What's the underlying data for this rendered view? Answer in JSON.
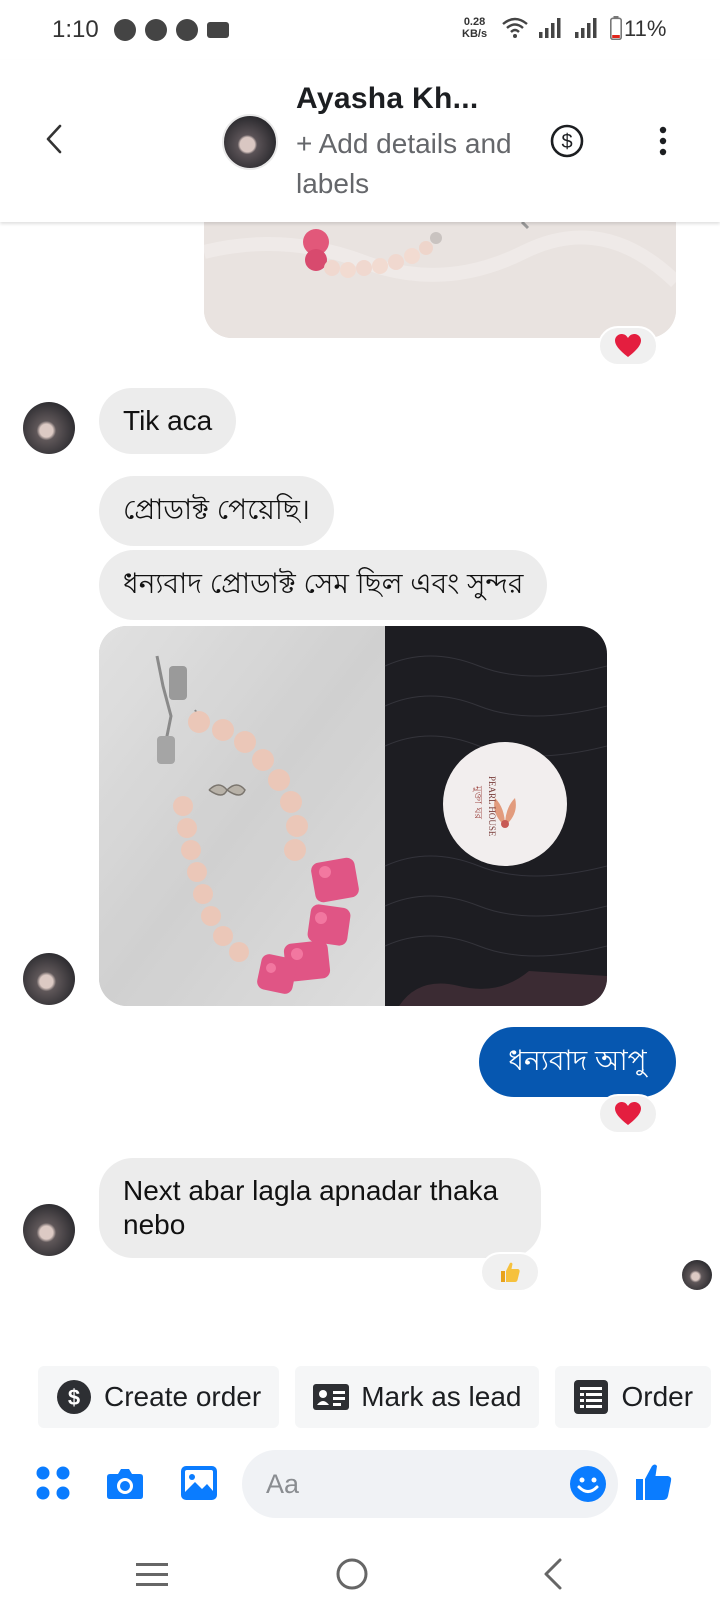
{
  "status_bar": {
    "time": "1:10",
    "net_speed_value": "0.28",
    "net_speed_unit": "KB/s",
    "battery": "11%"
  },
  "header": {
    "contact_name": "Ayasha Kh...",
    "subtitle": "+ Add details and labels",
    "back_icon": "chevron-left-icon",
    "payment_icon": "dollar-circle-icon",
    "more_icon": "more-vertical-icon"
  },
  "messages": [
    {
      "kind": "image",
      "direction": "outgoing",
      "reaction": "heart"
    },
    {
      "kind": "text",
      "direction": "incoming",
      "text": "Tik aca"
    },
    {
      "kind": "text",
      "direction": "incoming",
      "text": "প্রোডাক্ট পেয়েছি।"
    },
    {
      "kind": "text",
      "direction": "incoming",
      "text": "ধন্যবাদ প্রোডাক্ট সেম ছিল এবং সুন্দর"
    },
    {
      "kind": "image",
      "direction": "incoming",
      "logo_text": "PEARL HOUSE",
      "logo_bangla": "মুক্তা ঘর"
    },
    {
      "kind": "text",
      "direction": "outgoing",
      "text": "ধন্যবাদ আপু",
      "reaction": "heart"
    },
    {
      "kind": "text",
      "direction": "incoming",
      "text": "Next abar lagla apnadar thaka nebo",
      "reaction": "thumbs-up"
    }
  ],
  "quick_actions": [
    {
      "label": "Create order",
      "icon": "dollar-circle-icon"
    },
    {
      "label": "Mark as lead",
      "icon": "contact-card-icon"
    },
    {
      "label": "Order",
      "icon": "receipt-icon"
    }
  ],
  "composer": {
    "placeholder": "Aa",
    "icons": [
      "apps-icon",
      "camera-icon",
      "gallery-icon",
      "emoji-icon",
      "thumbs-up-icon"
    ]
  },
  "colors": {
    "outgoing_bubble": "#0657b0",
    "incoming_bubble": "#ececec",
    "accent": "#0a7cff",
    "heart": "#e41e3f"
  }
}
